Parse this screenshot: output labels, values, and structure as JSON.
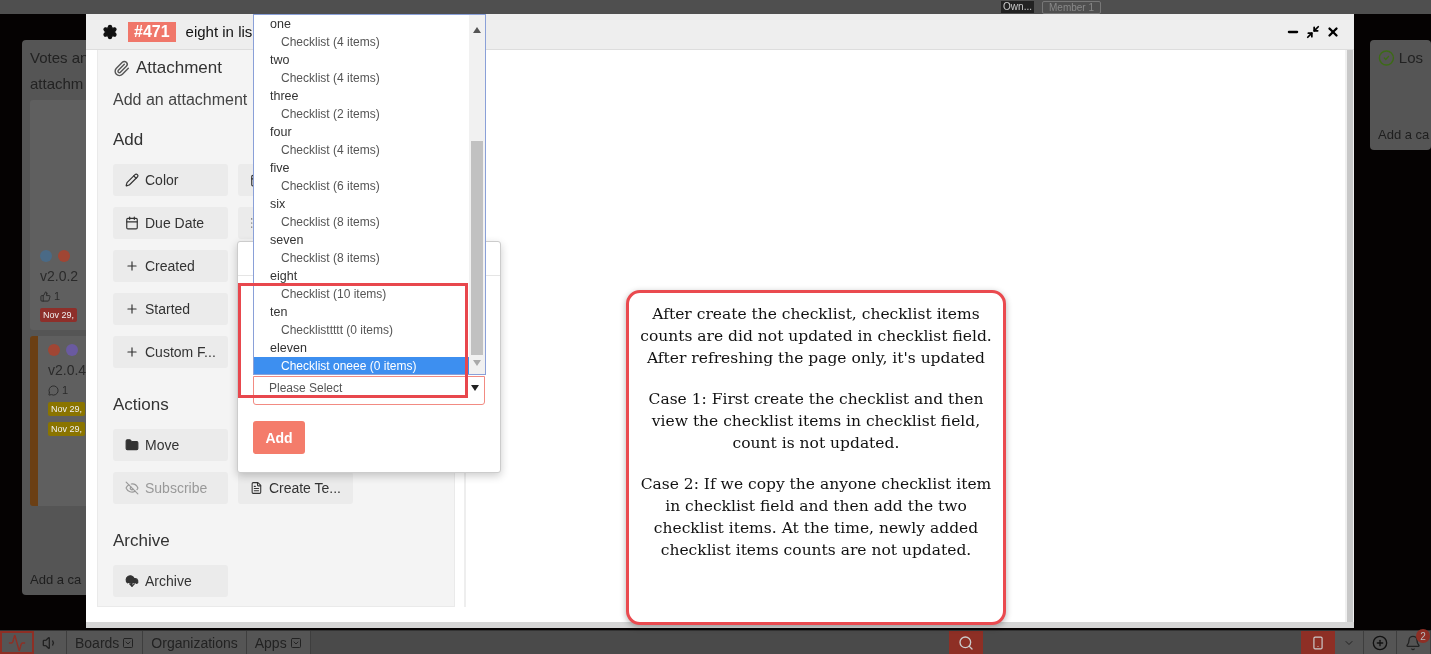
{
  "top_bar": {
    "owner_badge": "Own...",
    "member_label": "Member 1"
  },
  "board": {
    "lists": [
      {
        "kind": "cards",
        "title_lines": [
          "Votes an",
          "attachm"
        ],
        "cards": [
          {
            "kind": "votes",
            "labels": [
              {
                "color": "#4a6a86"
              },
              {
                "color": "#a04634"
              }
            ],
            "version": "v2.0.2",
            "count": "1",
            "dates": [
              {
                "text": "Nov 29,",
                "color": "#8e2f2a"
              }
            ]
          },
          {
            "kind": "comments",
            "labels": [
              {
                "color": "#a04634"
              },
              {
                "color": "#6a5aa0"
              }
            ],
            "version": "v2.0.4",
            "count": "1",
            "dates": [
              {
                "text": "Nov 29,",
                "color": "#8a7400"
              },
              {
                "text": "Nov 29,",
                "color": "#8a7400"
              }
            ]
          }
        ],
        "add_card": "Add a ca"
      },
      {
        "kind": "done",
        "title_lines": [
          "Los"
        ],
        "add_card": "Add a ca"
      }
    ]
  },
  "modal": {
    "number": "#471",
    "title": "eight in lis",
    "attachment": {
      "heading": "Attachment",
      "prompt": "Add an attachment"
    },
    "sections": [
      {
        "heading": "Add",
        "rows": [
          [
            {
              "label": "Color",
              "disabled": false
            },
            {
              "disabled": false
            }
          ],
          [
            {
              "label": "Due Date",
              "disabled": false
            },
            {
              "disabled": false
            }
          ],
          [
            {
              "label": "Created",
              "disabled": false
            }
          ],
          [
            {
              "label": "Started",
              "disabled": false
            }
          ],
          [
            {
              "label": "Custom F...",
              "disabled": false
            }
          ]
        ]
      },
      {
        "heading": "Actions",
        "rows": [
          [
            {
              "label": "Move",
              "disabled": false
            }
          ],
          [
            {
              "label": "Subscribe",
              "disabled": true
            },
            {
              "label": "Create Te...",
              "disabled": false
            }
          ]
        ]
      },
      {
        "heading": "Archive",
        "rows": [
          [
            {
              "label": "Archive",
              "disabled": false
            }
          ]
        ]
      }
    ],
    "popup": {
      "listbox": {
        "groups": [
          {
            "label": "one",
            "options": [
              {
                "label": "Checklist (4 items)",
                "selected": false
              }
            ]
          },
          {
            "label": "two",
            "options": [
              {
                "label": "Checklist (4 items)",
                "selected": false
              }
            ]
          },
          {
            "label": "three",
            "options": [
              {
                "label": "Checklist (2 items)",
                "selected": false
              }
            ]
          },
          {
            "label": "four",
            "options": [
              {
                "label": "Checklist (4 items)",
                "selected": false
              }
            ]
          },
          {
            "label": "five",
            "options": [
              {
                "label": "Checklist (6 items)",
                "selected": false
              }
            ]
          },
          {
            "label": "six",
            "options": [
              {
                "label": "Checklist (8 items)",
                "selected": false
              }
            ]
          },
          {
            "label": "seven",
            "options": [
              {
                "label": "Checklist (8 items)",
                "selected": false
              }
            ]
          },
          {
            "label": "eight",
            "options": [
              {
                "label": "Checklist (10 items)",
                "selected": false
              }
            ]
          },
          {
            "label": "ten",
            "options": [
              {
                "label": "Checklisttttt (0 items)",
                "selected": false
              }
            ]
          },
          {
            "label": "eleven",
            "options": [
              {
                "label": "Checklist oneee (0 items)",
                "selected": true
              }
            ]
          }
        ]
      },
      "select": {
        "placeholder": "Please Select",
        "invalid": true
      },
      "add_button": "Add"
    },
    "callout": {
      "paragraphs": [
        "After create the checklist, checklist items counts are did not updated in checklist field. After refreshing the page only, it's updated",
        "Case 1: First create the checklist and then view the checklist items in checklist field, count is not updated.",
        "Case 2: If we copy the anyone checklist item in checklist field and then add the two  checklist items. At the time, newly added checklist items counts are not updated."
      ]
    }
  },
  "taskbar": {
    "items": [
      {
        "label": "Boards",
        "caret": true
      },
      {
        "label": "Organizations",
        "caret": false
      },
      {
        "label": "Apps",
        "caret": true
      }
    ],
    "notification_count": "2"
  }
}
